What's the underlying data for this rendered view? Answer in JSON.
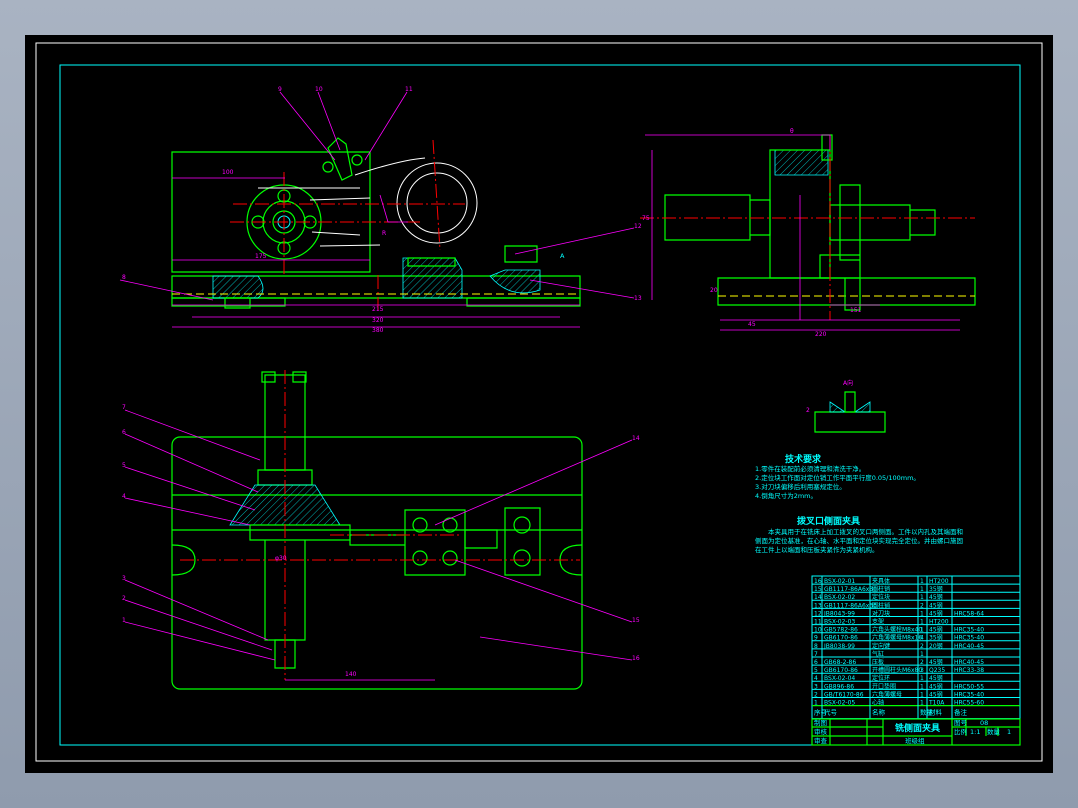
{
  "drawing": {
    "title": "铣侧面夹具",
    "drawing_number": "08",
    "scale_label": "比例",
    "scale": "1:1",
    "quantity_label": "数量",
    "quantity": "1",
    "number_label": "图号",
    "designed_label": "制图",
    "checked_label": "审核",
    "approved_label": "审查",
    "school": "班级组",
    "colors": {
      "frame": "#00ff00",
      "text": "#00ffff",
      "dimension": "#ff00ff",
      "centerline": "#ff0000",
      "hidden": "#ffff00",
      "background": "#000000"
    }
  },
  "parts_list": {
    "headers": [
      "序号",
      "代号",
      "名称",
      "数量",
      "材料",
      "备注"
    ],
    "rows": [
      [
        "16",
        "BSX-02-01",
        "夹具体",
        "1",
        "HT200",
        ""
      ],
      [
        "15",
        "GB1117-86A6x30",
        "圆柱销",
        "1",
        "35钢",
        ""
      ],
      [
        "14",
        "BSX-02-02",
        "定位块",
        "1",
        "45钢",
        ""
      ],
      [
        "13",
        "GB1117-86A6x30",
        "圆柱销",
        "2",
        "45钢",
        ""
      ],
      [
        "12",
        "JB8043-99",
        "对刀块",
        "1",
        "45钢",
        "HRC58-64"
      ],
      [
        "11",
        "BSX-02-03",
        "支架",
        "1",
        "HT200",
        ""
      ],
      [
        "10",
        "GB5782-86",
        "六角头螺栓M8x40",
        "1",
        "45钢",
        "HRC35-40"
      ],
      [
        "9",
        "GB6170-86",
        "六角薄螺母M8x16",
        "4",
        "35钢",
        "HRC35-40"
      ],
      [
        "8",
        "JB8038-99",
        "定向键",
        "2",
        "20钢",
        "HRC40-45"
      ],
      [
        "7",
        "",
        "气缸",
        "1",
        "",
        ""
      ],
      [
        "6",
        "GB68-2-86",
        "压板",
        "2",
        "45钢",
        "HRC40-45"
      ],
      [
        "5",
        "GB6170-86",
        "开槽圆柱头M6x80",
        "3",
        "Q235",
        "HRC33-38"
      ],
      [
        "4",
        "BSX-02-04",
        "定位环",
        "1",
        "45钢",
        ""
      ],
      [
        "3",
        "GB896-86",
        "开口垫圈",
        "1",
        "45钢",
        "HRC50-55"
      ],
      [
        "2",
        "GB/T6170-86",
        "六角薄螺母",
        "1",
        "45钢",
        "HRC35-40"
      ],
      [
        "1",
        "BSX-02-05",
        "心轴",
        "1",
        "T10A",
        "HRC55-60"
      ]
    ]
  },
  "tech_requirements": {
    "title": "技术要求",
    "items": [
      "1.零件在装配前必须清理和清洗干净。",
      "2.定位块工作面对定位销工作平面平行度0.05/100mm。",
      "3.对刀块偏移后利用塞规定位。",
      "4.倒角尺寸为2mm。"
    ]
  },
  "description": {
    "title": "拨叉口侧面夹具",
    "lines": [
      "本夹具用于在铣床上加工拨叉的叉口两侧面。工件以内孔及其端面和",
      "侧面为定位基准，在心轴、水平面和定位块实现完全定位。并由螺口施固",
      "在工件上以端面和压板夹紧作为夹紧机构。"
    ]
  },
  "views": {
    "front_balloons": [
      "9",
      "10",
      "11",
      "12",
      "13",
      "8"
    ],
    "front_dimensions": [
      "100",
      "175",
      "R",
      "215",
      "320",
      "380"
    ],
    "side_dimensions": [
      "θ",
      "151",
      "45",
      "220",
      "75",
      "20"
    ],
    "top_balloons": [
      "7",
      "6",
      "5",
      "4",
      "3",
      "2",
      "1",
      "14",
      "15",
      "16"
    ],
    "top_dimensions": [
      "140",
      "φ30"
    ],
    "section_label": "A",
    "detail_label": "A向",
    "detail_dimension": "2"
  }
}
